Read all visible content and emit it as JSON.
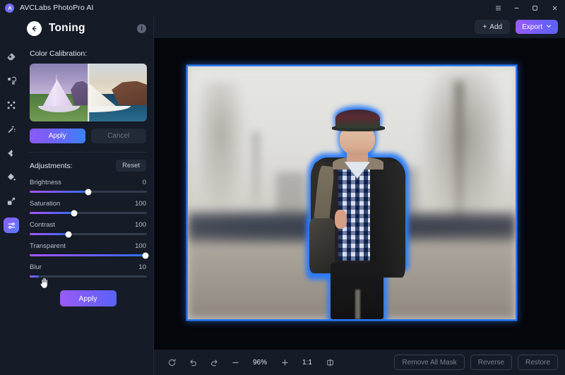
{
  "titlebar": {
    "app_name": "AVCLabs PhotoPro AI",
    "logo_icon": "avclabs-logo-icon",
    "menu_icon": "hamburger-menu-icon",
    "minimize_icon": "minimize-icon",
    "maximize_icon": "maximize-icon",
    "close_icon": "close-icon"
  },
  "rail": {
    "items": [
      {
        "icon": "eraser-icon",
        "active": false
      },
      {
        "icon": "object-remove-icon",
        "active": false
      },
      {
        "icon": "expand-corners-icon",
        "active": false
      },
      {
        "icon": "magic-wand-icon",
        "active": false
      },
      {
        "icon": "enhance-sparkle-icon",
        "active": false
      },
      {
        "icon": "paint-bucket-icon",
        "active": false
      },
      {
        "icon": "resize-arrow-icon",
        "active": false
      },
      {
        "icon": "toning-sliders-icon",
        "active": true
      }
    ]
  },
  "panel": {
    "back_icon": "back-arrow-icon",
    "title": "Toning",
    "info_icon": "info-icon",
    "info_glyph": "i",
    "calibration": {
      "label": "Color Calibration:",
      "preview_name": "sailboat-before-after-preview",
      "apply_label": "Apply",
      "cancel_label": "Cancel"
    },
    "adjustments": {
      "label": "Adjustments:",
      "reset_label": "Reset",
      "sliders": [
        {
          "name": "Brightness",
          "value": "0",
          "percent": 50
        },
        {
          "name": "Saturation",
          "value": "100",
          "percent": 38
        },
        {
          "name": "Contrast",
          "value": "100",
          "percent": 33
        },
        {
          "name": "Transparent",
          "value": "100",
          "percent": 99
        },
        {
          "name": "Blur",
          "value": "10",
          "percent": 8
        }
      ],
      "apply_label": "Apply"
    }
  },
  "toolbar": {
    "add_label": "Add",
    "add_icon": "plus-icon",
    "export_label": "Export",
    "export_chevron_icon": "chevron-down-icon"
  },
  "canvas": {
    "photo_name": "street-portrait-young-man",
    "mask_outline_color": "#2b7bf6",
    "selection_border_color": "#2b7bf6"
  },
  "bottombar": {
    "reset_view_icon": "rotate-reset-icon",
    "undo_icon": "undo-icon",
    "redo_icon": "redo-icon",
    "zoom_out_icon": "minus-icon",
    "zoom_level": "96%",
    "zoom_in_icon": "plus-icon",
    "fit_label": "1:1",
    "compare_icon": "split-compare-icon",
    "remove_all_mask_label": "Remove All Mask",
    "reverse_label": "Reverse",
    "restore_label": "Restore"
  },
  "colors": {
    "accent_purple": "#8b5cf6",
    "accent_blue": "#3b82f6",
    "panel_bg": "#151b27",
    "canvas_bg": "#05070c",
    "mask_blue": "#2b7bf6"
  }
}
